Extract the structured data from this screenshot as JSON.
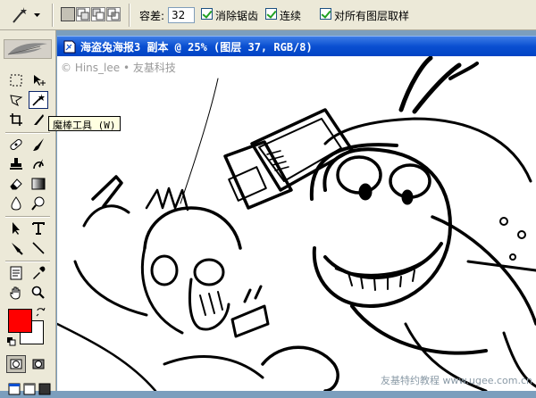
{
  "options_bar": {
    "tolerance_label": "容差:",
    "tolerance_value": "32",
    "antialias_label": "消除锯齿",
    "contiguous_label": "连续",
    "sample_all_label": "对所有图层取样"
  },
  "tooltip": {
    "text": "魔棒工具 (W)"
  },
  "colors": {
    "foreground": "#ff0000",
    "background": "#ffffff"
  },
  "document": {
    "title": "海盗兔海报3 副本 @ 25% (图层 37, RGB/8)",
    "copyright": "© Hins_lee • 友基科技",
    "watermark": "友基特约教程 www.ugee.com.cn"
  }
}
